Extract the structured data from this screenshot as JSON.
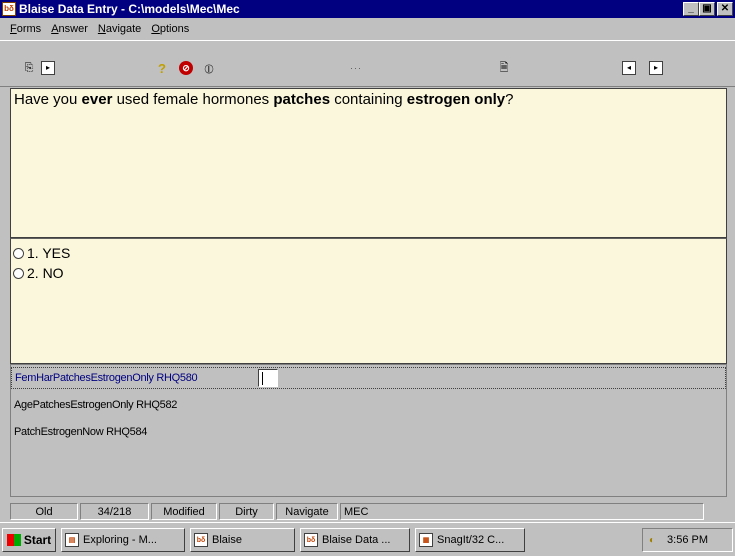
{
  "window": {
    "title": "Blaise Data Entry - C:\\models\\Mec\\Mec",
    "app_icon_text": "bδ",
    "controls": [
      "_",
      "▣",
      "✕"
    ]
  },
  "menu": [
    {
      "underline": "F",
      "rest": "orms"
    },
    {
      "underline": "A",
      "rest": "nswer"
    },
    {
      "underline": "N",
      "rest": "avigate"
    },
    {
      "underline": "O",
      "rest": "ptions"
    }
  ],
  "toolbar": {
    "dots": "···"
  },
  "question": {
    "parts": [
      {
        "text": "Have you ",
        "bold": false
      },
      {
        "text": "ever",
        "bold": true
      },
      {
        "text": " used female hormones ",
        "bold": false
      },
      {
        "text": "patches",
        "bold": true
      },
      {
        "text": " containing ",
        "bold": false
      },
      {
        "text": "estrogen only",
        "bold": true
      },
      {
        "text": "?",
        "bold": false
      }
    ]
  },
  "answers": [
    {
      "label": "1. YES"
    },
    {
      "label": "2. NO"
    }
  ],
  "fields": [
    {
      "label": "FemHarPatchesEstrogenOnly RHQ580",
      "active": true
    },
    {
      "label": "AgePatchesEstrogenOnly RHQ582",
      "active": false
    },
    {
      "label": "PatchEstrogenNow RHQ584",
      "active": false
    }
  ],
  "status": {
    "state": "Old",
    "position": "34/218",
    "modified": "Modified",
    "dirty": "Dirty",
    "mode": "Navigate",
    "form": "MEC"
  },
  "taskbar": {
    "start": "Start",
    "tasks": [
      {
        "label": "Exploring - M...",
        "icon": "folder-icon"
      },
      {
        "label": "Blaise",
        "icon": "blaise-icon"
      },
      {
        "label": "Blaise Data ...",
        "icon": "blaise-icon"
      },
      {
        "label": "SnagIt/32 C...",
        "icon": "snagit-icon"
      }
    ],
    "time": "3:56 PM"
  }
}
